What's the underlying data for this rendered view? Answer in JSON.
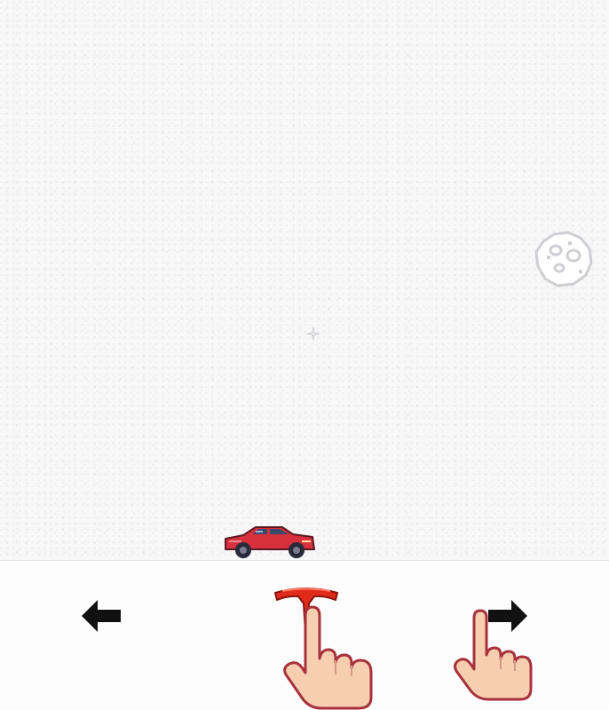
{
  "game": {
    "player": {
      "sprite": "red-tesla-roadster"
    },
    "obstacle": {
      "sprite": "asteroid"
    },
    "sparkle": {
      "sprite": "star-sparkle"
    }
  },
  "controls": {
    "left": {
      "icon": "arrow-left-icon",
      "action": "move-left"
    },
    "center": {
      "icon": "tesla-logo-icon",
      "action": "fire"
    },
    "right": {
      "icon": "arrow-right-icon",
      "action": "move-right"
    },
    "hints": [
      "pointing-hand-icon",
      "pointing-hand-icon"
    ]
  },
  "colors": {
    "background": "#f8f8f8",
    "ground_line": "#e2e2e6",
    "car_body": "#d8303c",
    "tesla_red": "#e02a1a",
    "hand_skin": "#f6cfb0",
    "hand_outline": "#a8323c"
  }
}
